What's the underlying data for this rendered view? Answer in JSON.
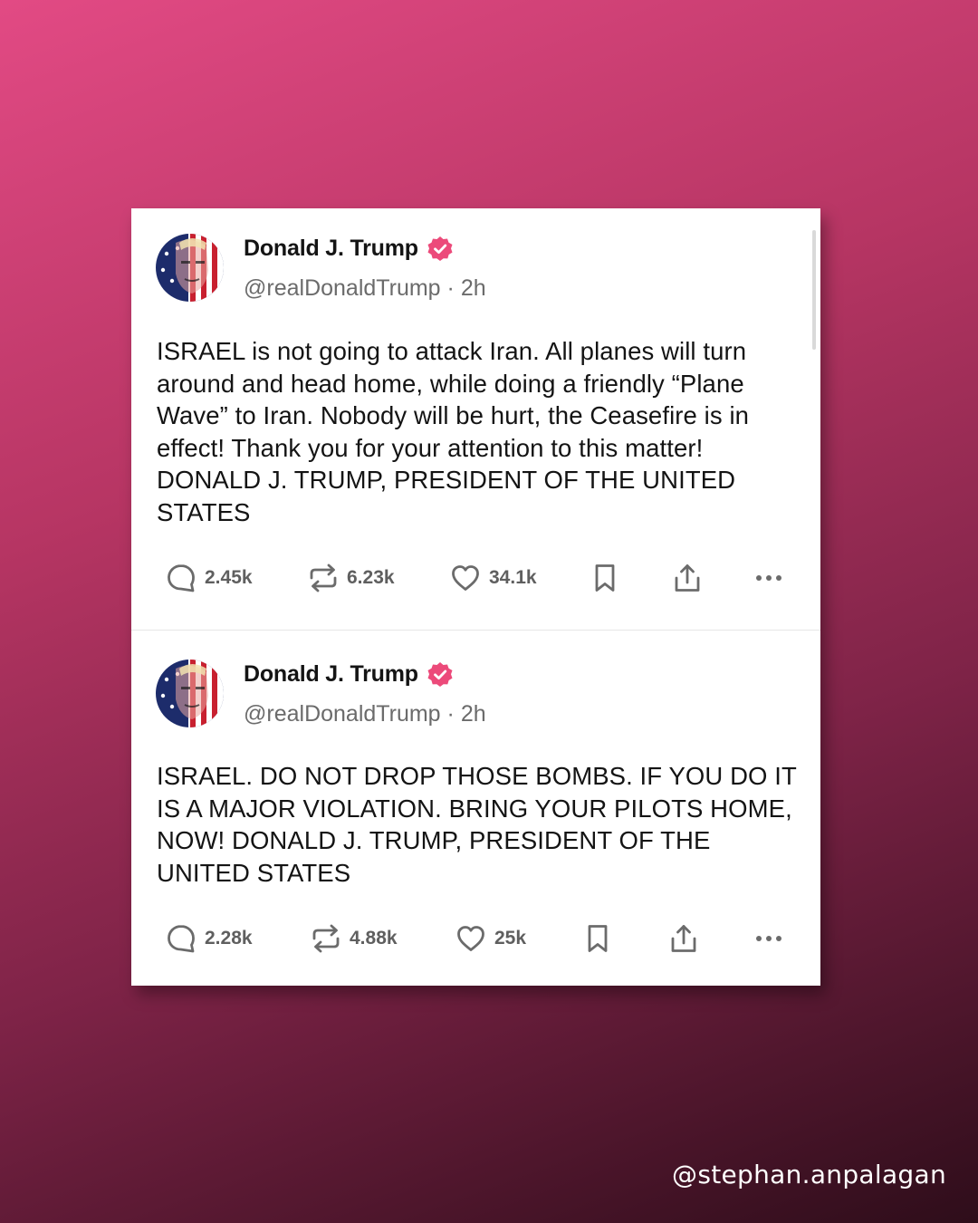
{
  "posts": [
    {
      "author": {
        "name": "Donald J. Trump",
        "handle": "@realDonaldTrump",
        "separator": "·",
        "time": "2h",
        "avatar": "avatar-flag-portrait"
      },
      "text": "ISRAEL is not going to attack Iran. All planes will turn around and head home, while doing a friendly “Plane Wave” to Iran. Nobody will be hurt, the Ceasefire is in effect! Thank you for your attention to this matter! DONALD J. TRUMP, PRESIDENT OF THE UNITED STATES",
      "stats": {
        "replies": "2.45k",
        "reposts": "6.23k",
        "likes": "34.1k"
      }
    },
    {
      "author": {
        "name": "Donald J. Trump",
        "handle": "@realDonaldTrump",
        "separator": "·",
        "time": "2h",
        "avatar": "avatar-flag-portrait"
      },
      "text": "ISRAEL. DO NOT DROP THOSE BOMBS. IF YOU DO IT IS A MAJOR VIOLATION. BRING YOUR PILOTS HOME, NOW!  DONALD J. TRUMP, PRESIDENT OF THE UNITED STATES",
      "stats": {
        "replies": "2.28k",
        "reposts": "4.88k",
        "likes": "25k"
      }
    }
  ],
  "icons": [
    "verified-badge-icon",
    "reply-icon",
    "repost-icon",
    "like-icon",
    "bookmark-icon",
    "share-icon",
    "more-icon"
  ],
  "colors": {
    "verified": "#ec4a7a",
    "background_top": "#e24a84",
    "background_bottom": "#2e0d1a"
  },
  "watermark": "@stephan.anpalagan"
}
